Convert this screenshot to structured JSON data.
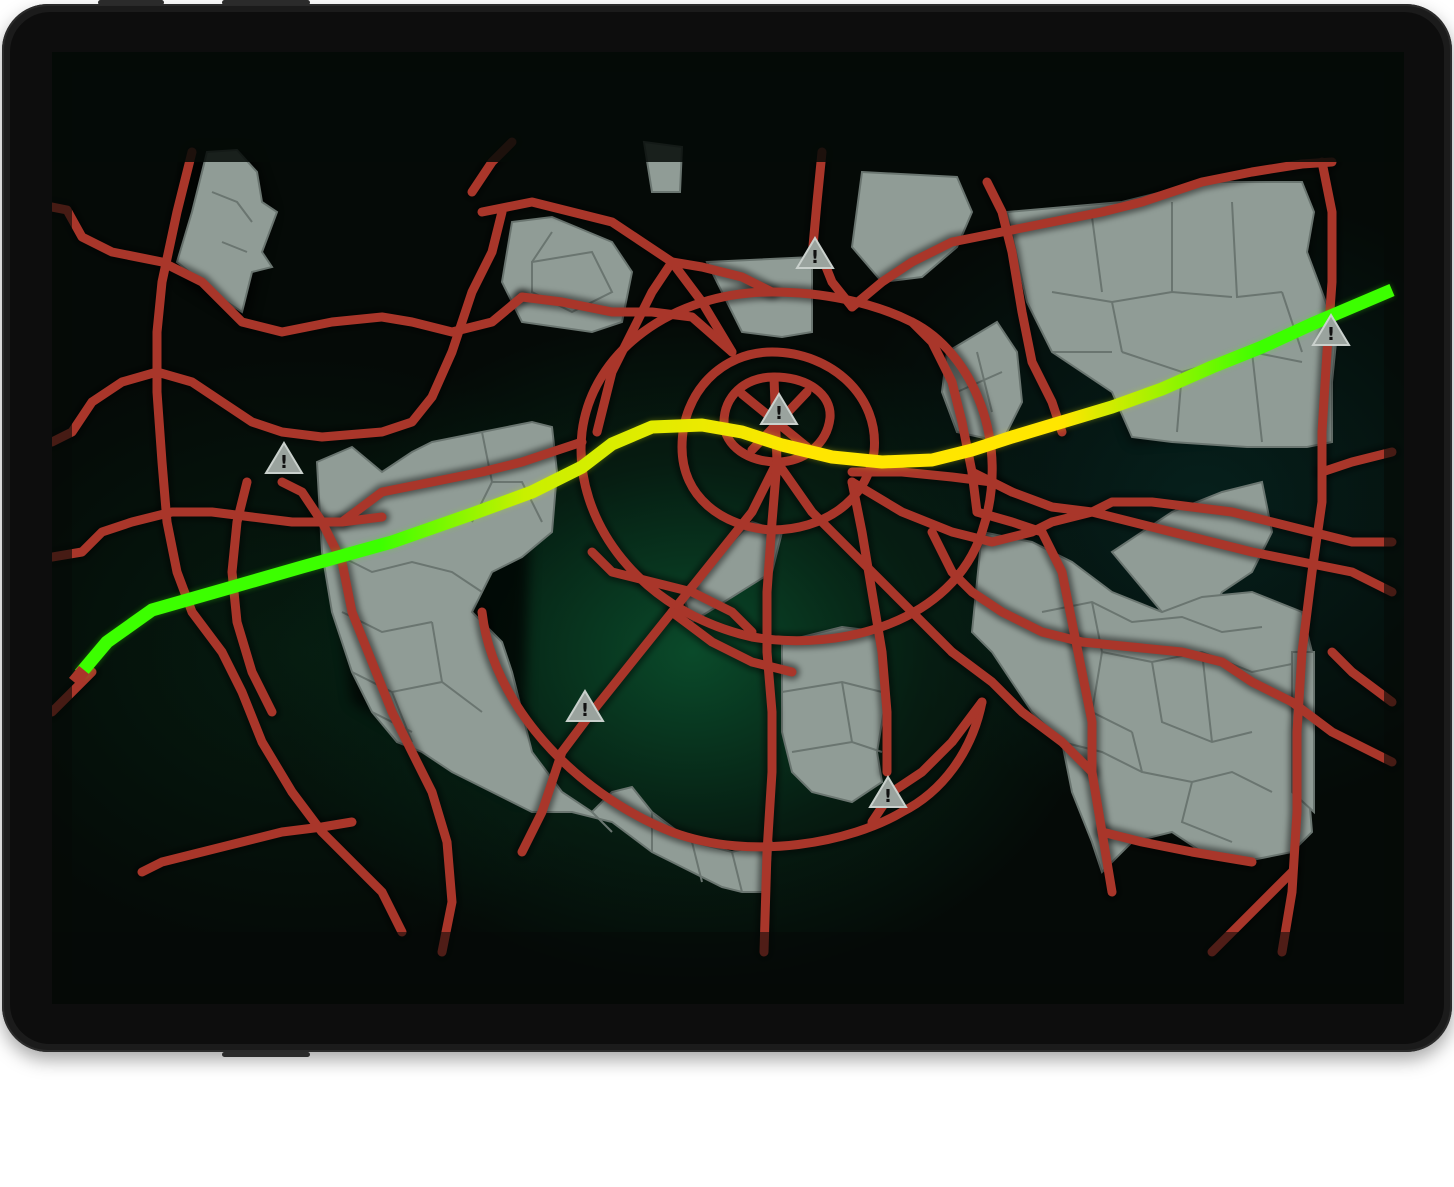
{
  "device": {
    "type": "tablet",
    "frame_color": "#1b1b1b",
    "screen_bg": "#050a07"
  },
  "map": {
    "road_color": "#a9362a",
    "block_color": "#909c96",
    "route": {
      "color_stops": [
        "#3cff00",
        "#ffe600",
        "#3cff00"
      ],
      "gradient_offsets": [
        0.0,
        0.23,
        0.34,
        0.55,
        0.75,
        0.9,
        1.0
      ],
      "gradient_colors": [
        "#3cff00",
        "#3cff00",
        "#c8f000",
        "#ffe600",
        "#ffe600",
        "#3cff00",
        "#3cff00"
      ]
    },
    "warnings": [
      {
        "name": "warning-icon-top-center"
      },
      {
        "name": "warning-icon-center"
      },
      {
        "name": "warning-icon-left"
      },
      {
        "name": "warning-icon-bottom-left"
      },
      {
        "name": "warning-icon-bottom-center"
      },
      {
        "name": "warning-icon-right"
      }
    ],
    "warning_glyph": "!"
  }
}
